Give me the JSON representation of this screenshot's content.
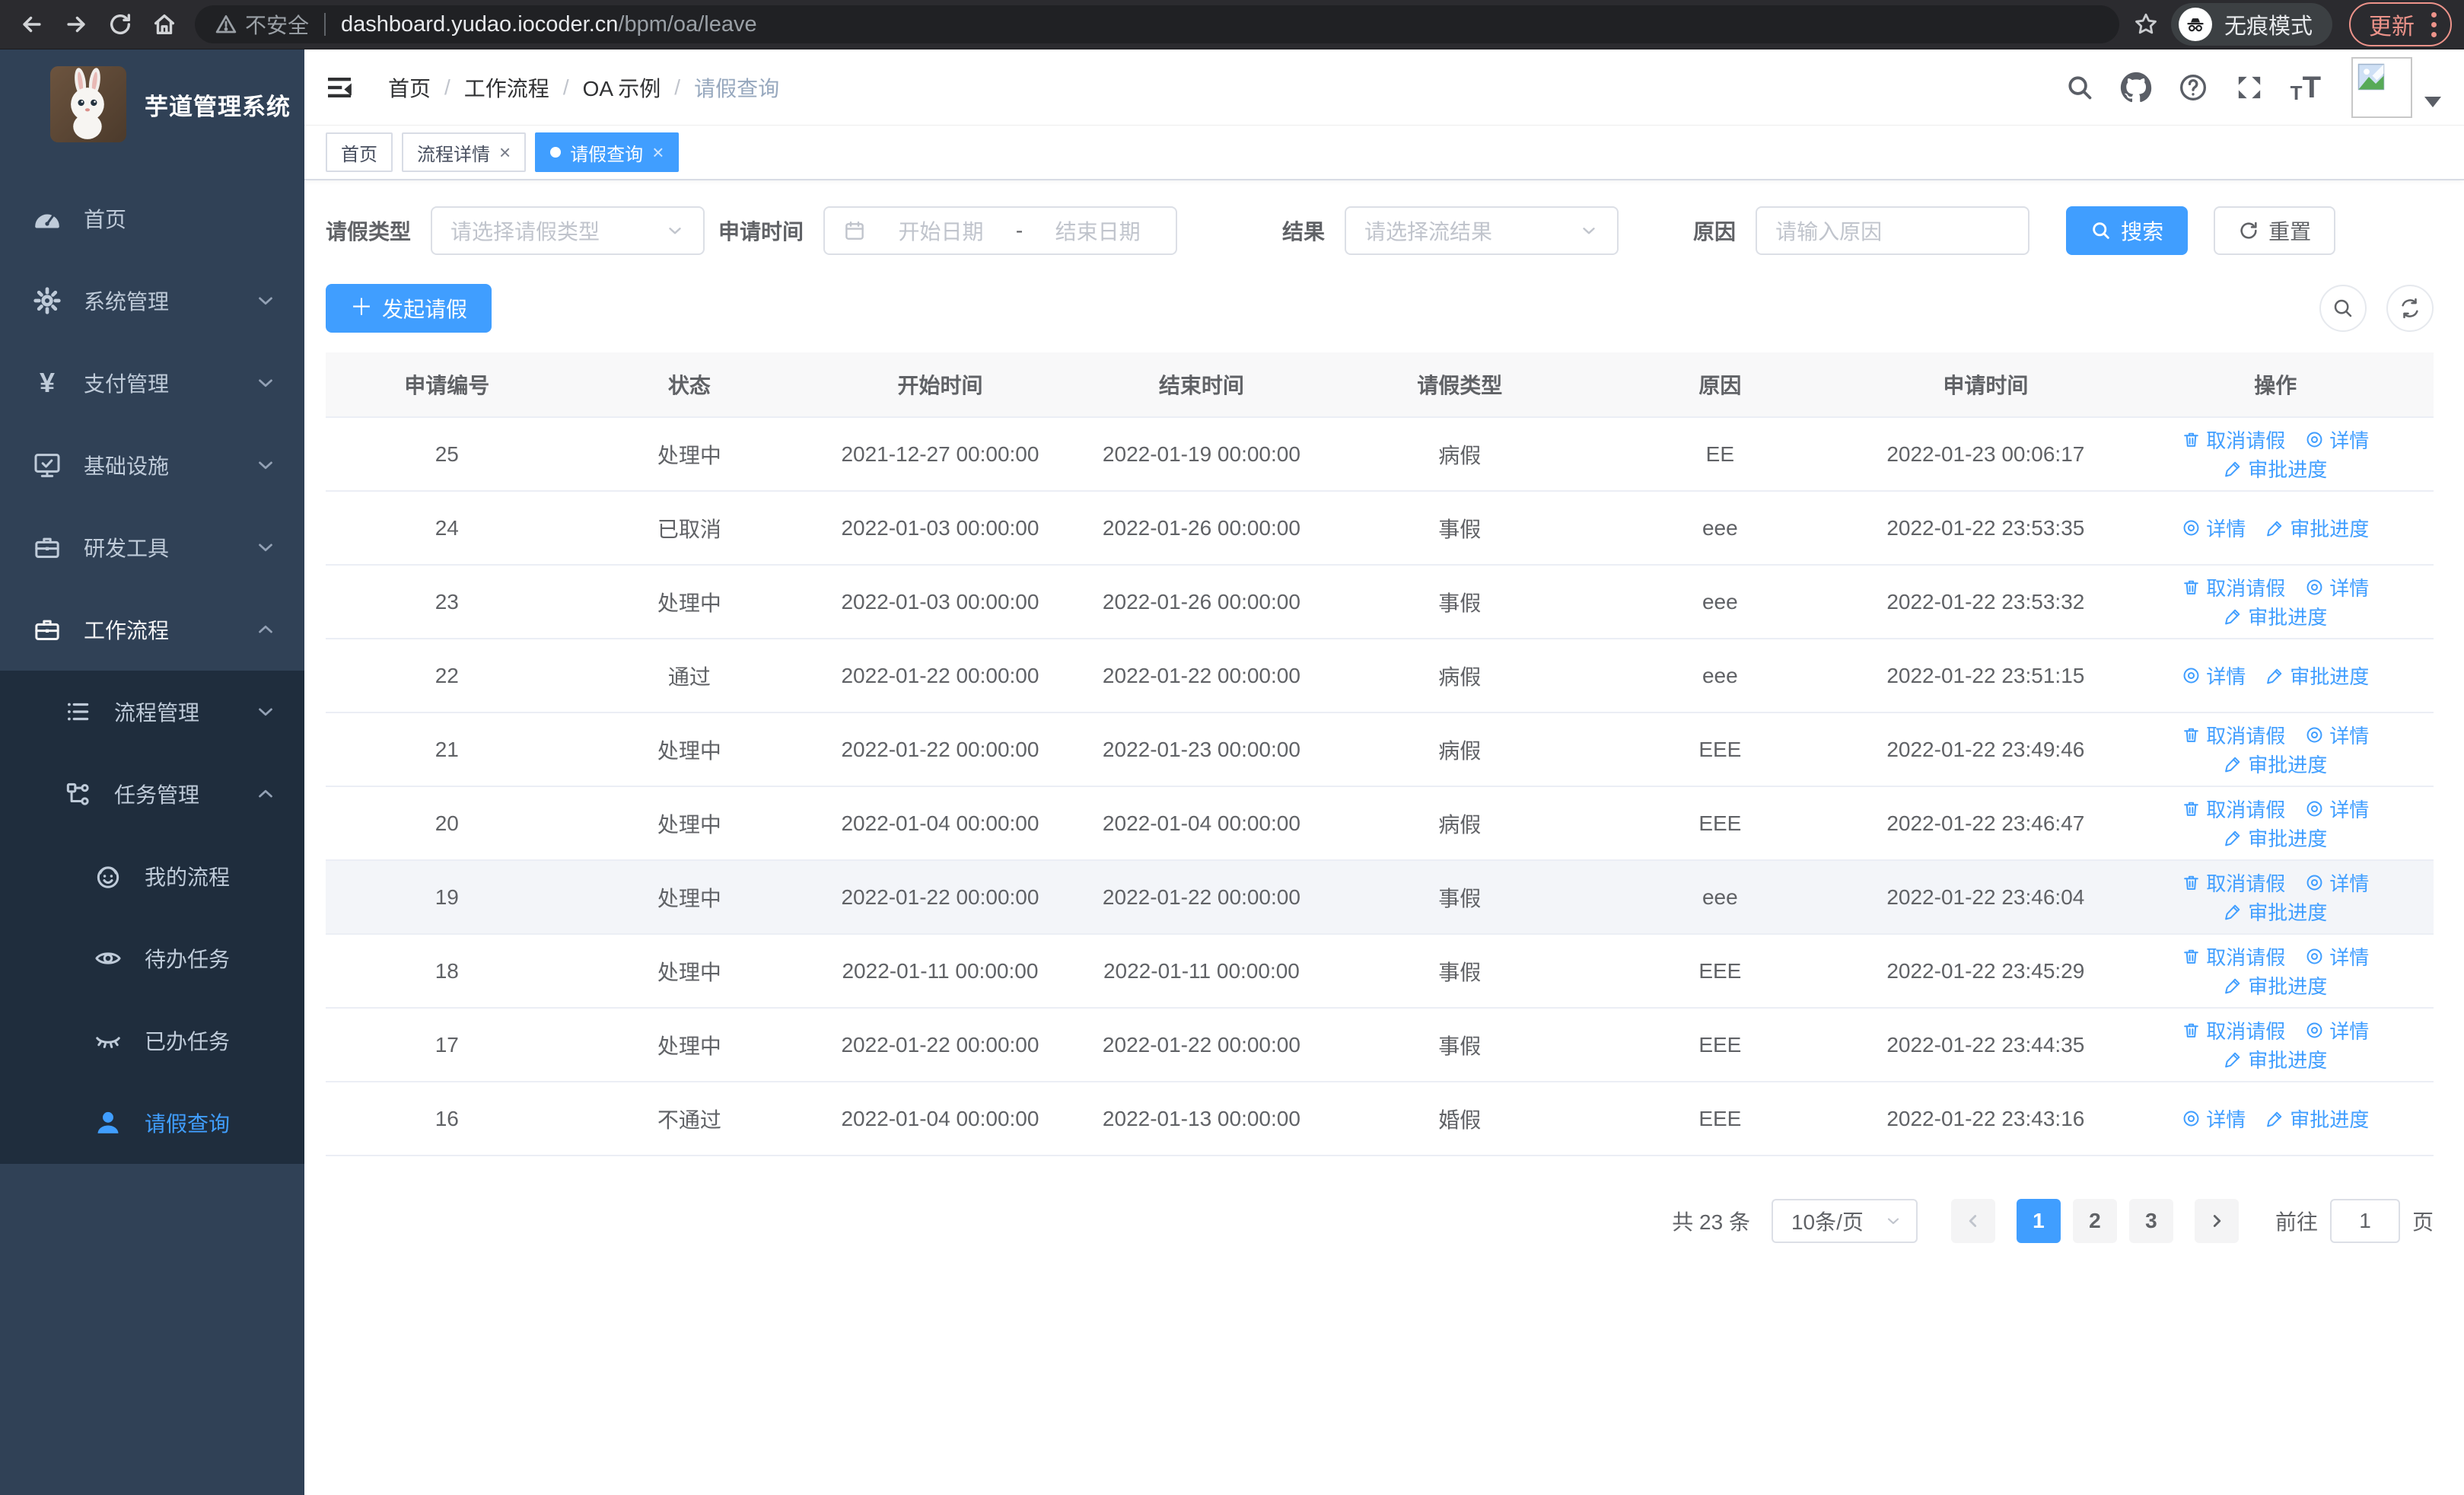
{
  "browser": {
    "security_label": "不安全",
    "url_host": "dashboard.yudao.iocoder.cn",
    "url_path": "/bpm/oa/leave",
    "incognito_label": "无痕模式",
    "update_label": "更新"
  },
  "icons": {
    "close": "×",
    "plus": "＋"
  },
  "sidebar": {
    "title": "芋道管理系统",
    "items": [
      {
        "label": "首页"
      },
      {
        "label": "系统管理"
      },
      {
        "label": "支付管理"
      },
      {
        "label": "基础设施"
      },
      {
        "label": "研发工具"
      },
      {
        "label": "工作流程"
      },
      {
        "label": "流程管理"
      },
      {
        "label": "任务管理"
      },
      {
        "label": "我的流程"
      },
      {
        "label": "待办任务"
      },
      {
        "label": "已办任务"
      },
      {
        "label": "请假查询"
      }
    ]
  },
  "navbar": {
    "breadcrumb": [
      {
        "label": "首页"
      },
      {
        "label": "工作流程"
      },
      {
        "label": "OA 示例"
      },
      {
        "label": "请假查询"
      }
    ]
  },
  "tags": [
    {
      "label": "首页",
      "closable": false,
      "active": false
    },
    {
      "label": "流程详情",
      "closable": true,
      "active": false
    },
    {
      "label": "请假查询",
      "closable": true,
      "active": true
    }
  ],
  "filter": {
    "type_label": "请假类型",
    "type_placeholder": "请选择请假类型",
    "time_label": "申请时间",
    "start_placeholder": "开始日期",
    "range_separator": "-",
    "end_placeholder": "结束日期",
    "result_label": "结果",
    "result_placeholder": "请选择流结果",
    "reason_label": "原因",
    "reason_placeholder": "请输入原因",
    "search_label": "搜索",
    "reset_label": "重置"
  },
  "toolbar": {
    "create_label": "发起请假"
  },
  "table": {
    "columns": [
      "申请编号",
      "状态",
      "开始时间",
      "结束时间",
      "请假类型",
      "原因",
      "申请时间",
      "操作"
    ],
    "action_labels": {
      "cancel": "取消请假",
      "detail": "详情",
      "progress": "审批进度"
    },
    "rows": [
      {
        "id": "25",
        "status": "处理中",
        "start": "2021-12-27 00:00:00",
        "end": "2022-01-19 00:00:00",
        "type": "病假",
        "reason": "EE",
        "apply": "2022-01-23 00:06:17",
        "actions": [
          "cancel",
          "detail",
          "progress"
        ],
        "highlight": false
      },
      {
        "id": "24",
        "status": "已取消",
        "start": "2022-01-03 00:00:00",
        "end": "2022-01-26 00:00:00",
        "type": "事假",
        "reason": "eee",
        "apply": "2022-01-22 23:53:35",
        "actions": [
          "detail",
          "progress"
        ],
        "highlight": false
      },
      {
        "id": "23",
        "status": "处理中",
        "start": "2022-01-03 00:00:00",
        "end": "2022-01-26 00:00:00",
        "type": "事假",
        "reason": "eee",
        "apply": "2022-01-22 23:53:32",
        "actions": [
          "cancel",
          "detail",
          "progress"
        ],
        "highlight": false
      },
      {
        "id": "22",
        "status": "通过",
        "start": "2022-01-22 00:00:00",
        "end": "2022-01-22 00:00:00",
        "type": "病假",
        "reason": "eee",
        "apply": "2022-01-22 23:51:15",
        "actions": [
          "detail",
          "progress"
        ],
        "highlight": false
      },
      {
        "id": "21",
        "status": "处理中",
        "start": "2022-01-22 00:00:00",
        "end": "2022-01-23 00:00:00",
        "type": "病假",
        "reason": "EEE",
        "apply": "2022-01-22 23:49:46",
        "actions": [
          "cancel",
          "detail",
          "progress"
        ],
        "highlight": false
      },
      {
        "id": "20",
        "status": "处理中",
        "start": "2022-01-04 00:00:00",
        "end": "2022-01-04 00:00:00",
        "type": "病假",
        "reason": "EEE",
        "apply": "2022-01-22 23:46:47",
        "actions": [
          "cancel",
          "detail",
          "progress"
        ],
        "highlight": false
      },
      {
        "id": "19",
        "status": "处理中",
        "start": "2022-01-22 00:00:00",
        "end": "2022-01-22 00:00:00",
        "type": "事假",
        "reason": "eee",
        "apply": "2022-01-22 23:46:04",
        "actions": [
          "cancel",
          "detail",
          "progress"
        ],
        "highlight": true
      },
      {
        "id": "18",
        "status": "处理中",
        "start": "2022-01-11 00:00:00",
        "end": "2022-01-11 00:00:00",
        "type": "事假",
        "reason": "EEE",
        "apply": "2022-01-22 23:45:29",
        "actions": [
          "cancel",
          "detail",
          "progress"
        ],
        "highlight": false
      },
      {
        "id": "17",
        "status": "处理中",
        "start": "2022-01-22 00:00:00",
        "end": "2022-01-22 00:00:00",
        "type": "事假",
        "reason": "EEE",
        "apply": "2022-01-22 23:44:35",
        "actions": [
          "cancel",
          "detail",
          "progress"
        ],
        "highlight": false
      },
      {
        "id": "16",
        "status": "不通过",
        "start": "2022-01-04 00:00:00",
        "end": "2022-01-13 00:00:00",
        "type": "婚假",
        "reason": "EEE",
        "apply": "2022-01-22 23:43:16",
        "actions": [
          "detail",
          "progress"
        ],
        "highlight": false
      }
    ]
  },
  "pagination": {
    "total_label": "共 23 条",
    "page_size_label": "10条/页",
    "pages": [
      "1",
      "2",
      "3"
    ],
    "active_page": "1",
    "goto_prefix": "前往",
    "goto_value": "1",
    "goto_suffix": "页"
  },
  "colors": {
    "primary": "#409eff",
    "sidebar_bg": "#304156",
    "submenu_bg": "#1f2d3d",
    "update_accent": "#ed938a"
  }
}
